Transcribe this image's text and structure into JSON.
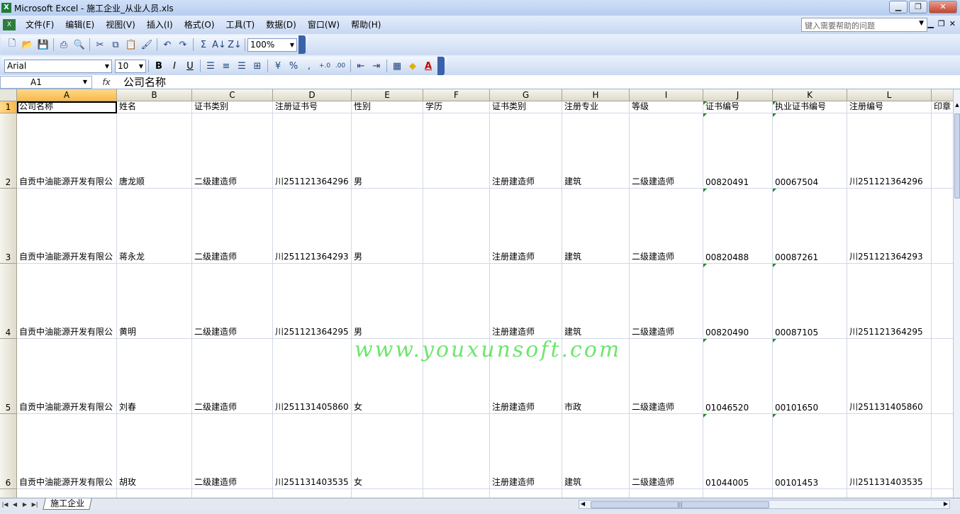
{
  "window": {
    "title": "Microsoft Excel - 施工企业_从业人员.xls",
    "app_icon": "excel-icon"
  },
  "menu": {
    "items": [
      "文件(F)",
      "编辑(E)",
      "视图(V)",
      "插入(I)",
      "格式(O)",
      "工具(T)",
      "数据(D)",
      "窗口(W)",
      "帮助(H)"
    ],
    "help_placeholder": "键入需要帮助的问题"
  },
  "toolbar": {
    "zoom": "100%",
    "font_name": "Arial",
    "font_size": "10",
    "bold": "B",
    "italic": "I",
    "underline": "U",
    "percent": "%",
    "comma": ",",
    "sum": "Σ"
  },
  "formula_bar": {
    "name_box": "A1",
    "fx": "fx",
    "content": "公司名称"
  },
  "columns": [
    {
      "letter": "A"
    },
    {
      "letter": "B"
    },
    {
      "letter": "C"
    },
    {
      "letter": "D"
    },
    {
      "letter": "E"
    },
    {
      "letter": "F"
    },
    {
      "letter": "G"
    },
    {
      "letter": "H"
    },
    {
      "letter": "I"
    },
    {
      "letter": "J"
    },
    {
      "letter": "K"
    },
    {
      "letter": "L"
    },
    {
      "letter": ""
    }
  ],
  "rows": [
    {
      "num": "1",
      "cells": [
        "公司名称",
        "姓名",
        "证书类别",
        "注册证书号",
        "性别",
        "学历",
        "证书类别",
        "注册专业",
        "等级",
        "证书编号",
        "执业证书编号",
        "注册编号",
        "印章"
      ]
    },
    {
      "num": "2",
      "cells": [
        "自贡中油能源开发有限公",
        "唐龙顺",
        "二级建造师",
        "川251121364296",
        "男",
        "",
        "注册建造师",
        "建筑",
        "二级建造师",
        "00820491",
        "00067504",
        "川251121364296",
        ""
      ]
    },
    {
      "num": "3",
      "cells": [
        "自贡中油能源开发有限公",
        "蒋永龙",
        "二级建造师",
        "川251121364293",
        "男",
        "",
        "注册建造师",
        "建筑",
        "二级建造师",
        "00820488",
        "00087261",
        "川251121364293",
        ""
      ]
    },
    {
      "num": "4",
      "cells": [
        "自贡中油能源开发有限公",
        "黄明",
        "二级建造师",
        "川251121364295",
        "男",
        "",
        "注册建造师",
        "建筑",
        "二级建造师",
        "00820490",
        "00087105",
        "川251121364295",
        ""
      ]
    },
    {
      "num": "5",
      "cells": [
        "自贡中油能源开发有限公",
        "刘春",
        "二级建造师",
        "川251131405860",
        "女",
        "",
        "注册建造师",
        "市政",
        "二级建造师",
        "01046520",
        "00101650",
        "川251131405860",
        ""
      ]
    },
    {
      "num": "6",
      "cells": [
        "自贡中油能源开发有限公",
        "胡玫",
        "二级建造师",
        "川251131403535",
        "女",
        "",
        "注册建造师",
        "建筑",
        "二级建造师",
        "01044005",
        "00101453",
        "川251131403535",
        ""
      ]
    },
    {
      "num": "",
      "cells": [
        "",
        "",
        "",
        "",
        "",
        "",
        "",
        "",
        "",
        "",
        "",
        "",
        ""
      ]
    }
  ],
  "watermark": "www.youxunsoft.com",
  "sheets": [
    "施工企业"
  ]
}
